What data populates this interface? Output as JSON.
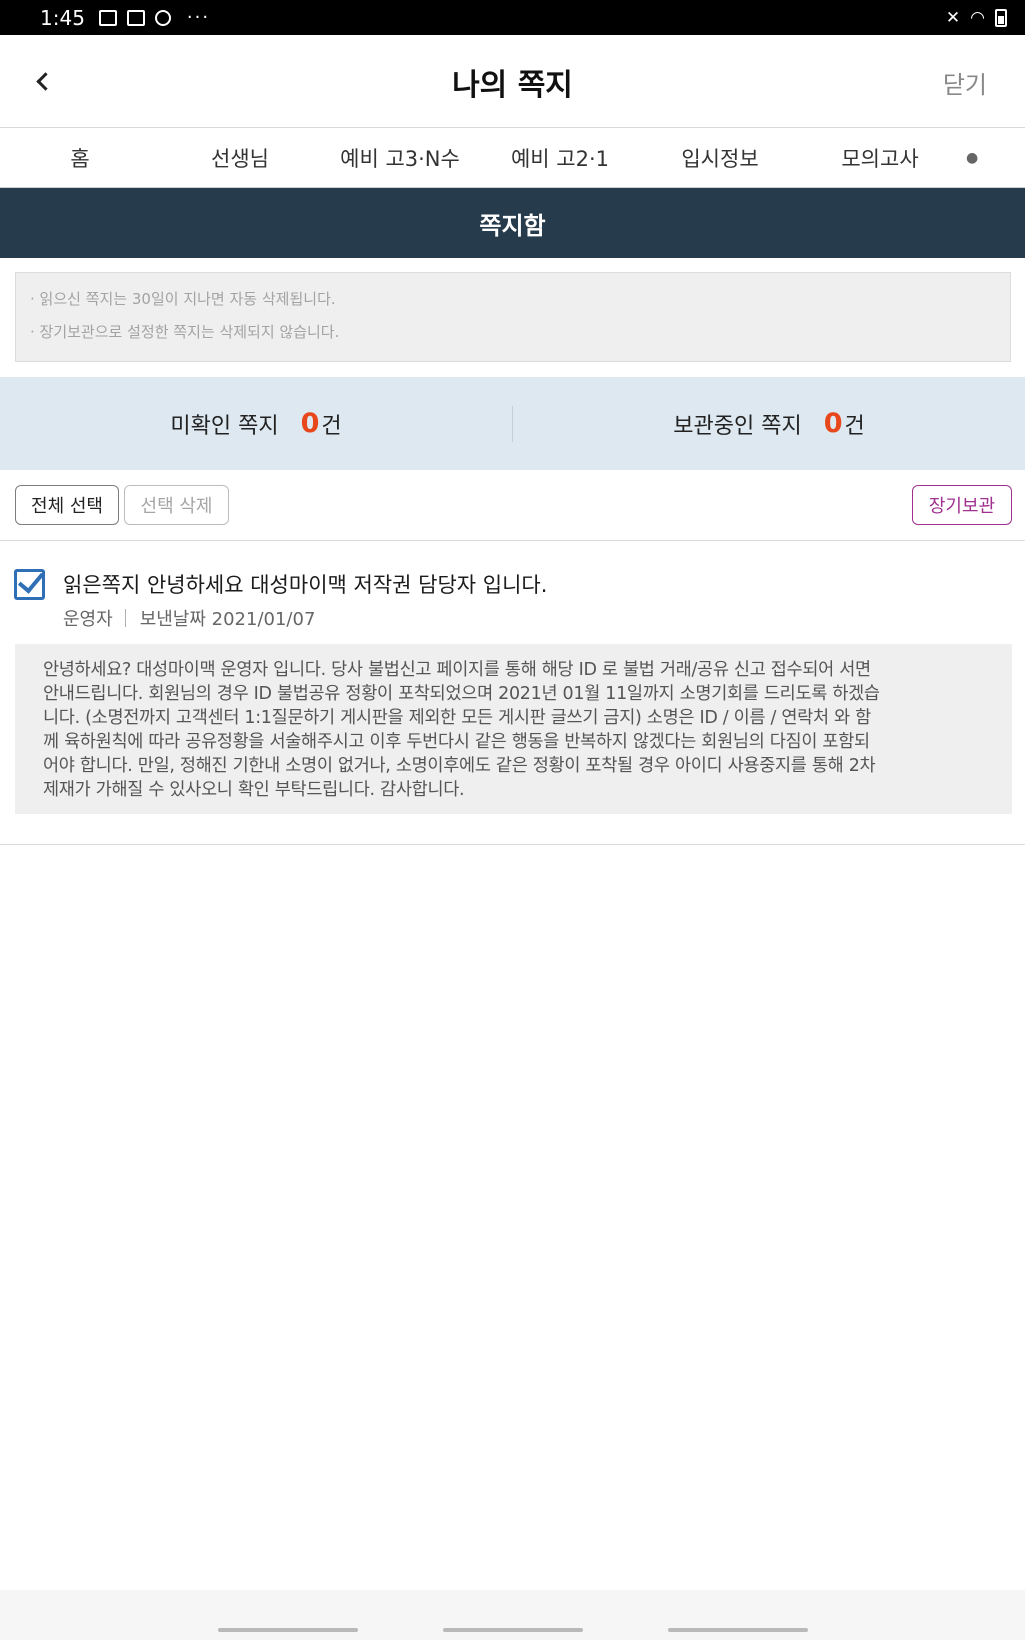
{
  "status_bar": {
    "time": "1:45",
    "more": "···"
  },
  "header": {
    "title": "나의 쪽지",
    "close_label": "닫기"
  },
  "tabs": [
    {
      "label": "홈"
    },
    {
      "label": "선생님"
    },
    {
      "label": "예비 고3·N수"
    },
    {
      "label": "예비 고2·1"
    },
    {
      "label": "입시정보"
    },
    {
      "label": "모의고사"
    }
  ],
  "section": {
    "title": "쪽지함"
  },
  "notice": {
    "lines": [
      "· 읽으신 쪽지는 30일이 지나면 자동 삭제됩니다.",
      "· 장기보관으로 설정한 쪽지는 삭제되지 않습니다."
    ]
  },
  "counts": {
    "unread_label": "미확인 쪽지",
    "unread_value": "0",
    "kept_label": "보관중인 쪽지",
    "kept_value": "0",
    "unit": "건"
  },
  "actions": {
    "select_all": "전체 선택",
    "delete_selected": "선택 삭제",
    "keep": "장기보관"
  },
  "messages": [
    {
      "checked": true,
      "title": "읽은쪽지 안녕하세요 대성마이맥 저작권 담당자 입니다.",
      "sender": "운영자",
      "date": "보낸날짜 2021/01/07",
      "body_lines": [
        "안녕하세요? 대성마이맥 운영자 입니다. 당사 불법신고 페이지를 통해 해당 ID 로 불법 거래/공유 신고 접수되어 서면",
        "안내드립니다. 회원님의 경우 ID 불법공유 정황이 포착되었으며 2021년 01월 11일까지 소명기회를 드리도록 하겠습",
        "니다. (소명전까지 고객센터 1:1질문하기 게시판을 제외한 모든 게시판 글쓰기 금지) 소명은 ID / 이름 / 연락처 와 함",
        "께 육하원칙에 따라 공유정황을 서술해주시고 이후 두번다시 같은 행동을 반복하지 않겠다는 회원님의 다짐이 포함되",
        "어야 합니다. 만일, 정해진 기한내 소명이 없거나, 소명이후에도 같은 정황이 포착될 경우 아이디 사용중지를 통해 2차",
        "제재가 가해질 수 있사오니 확인 부탁드립니다. 감사합니다."
      ]
    }
  ],
  "colors": {
    "section_bg": "#263b4c",
    "count_accent": "#e8471b",
    "keep_accent": "#a0308f",
    "checkbox": "#2f6fb5",
    "counts_bg": "#dde8f0"
  }
}
